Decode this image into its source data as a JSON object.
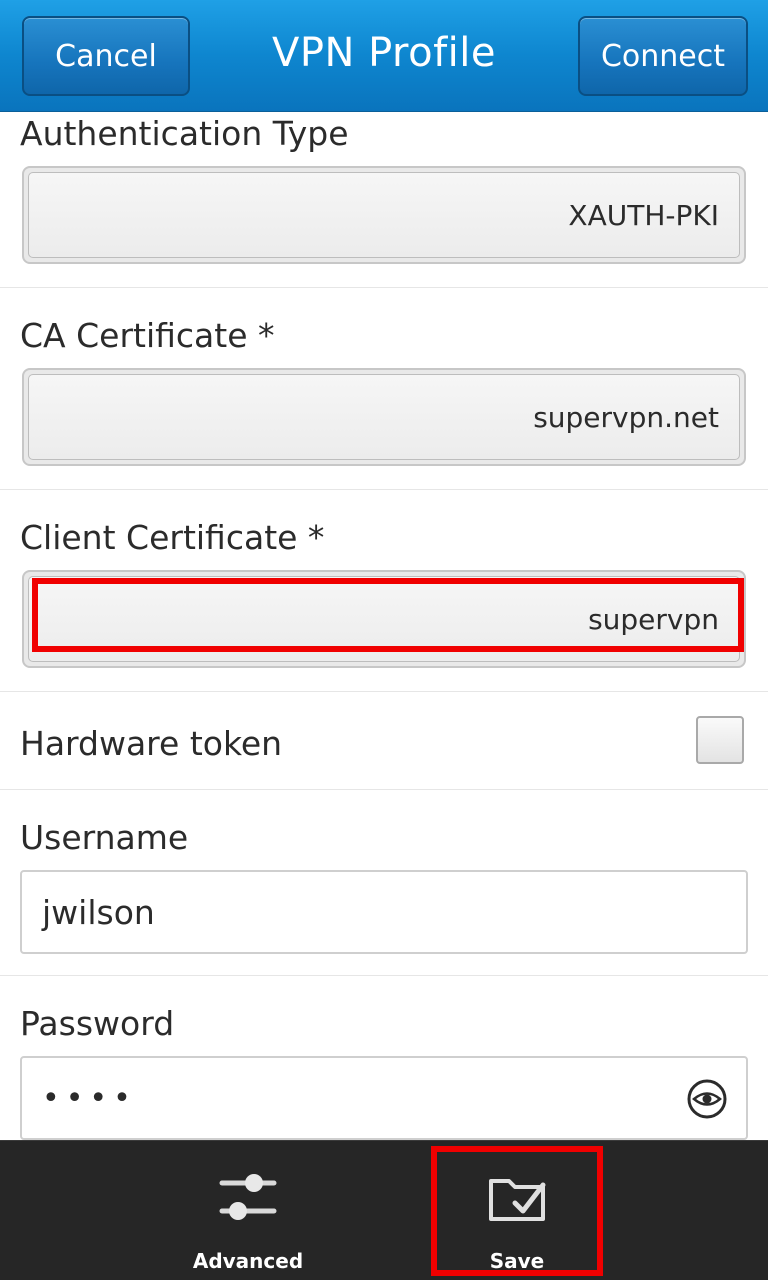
{
  "titlebar": {
    "title": "VPN Profile",
    "cancel_label": "Cancel",
    "connect_label": "Connect"
  },
  "form": {
    "auth_type": {
      "label": "Authentication Type",
      "value": "XAUTH-PKI"
    },
    "ca_cert": {
      "label": "CA Certificate *",
      "value": "supervpn.net"
    },
    "client_cert": {
      "label": "Client Certificate *",
      "value": "supervpn"
    },
    "hardware_token": {
      "label": "Hardware token",
      "checked": false
    },
    "username": {
      "label": "Username",
      "value": "jwilson"
    },
    "password": {
      "label": "Password",
      "value": "••••"
    }
  },
  "actionbar": {
    "advanced_label": "Advanced",
    "save_label": "Save"
  },
  "colors": {
    "titlebar": "#0e86cf",
    "highlight": "#f00000",
    "actionbar": "#262626"
  }
}
